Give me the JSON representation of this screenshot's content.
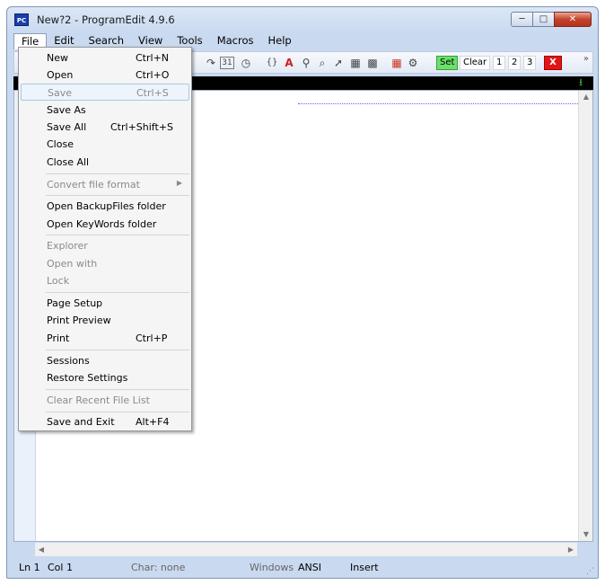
{
  "window": {
    "title": "New?2  -  ProgramEdit 4.9.6",
    "icon_label": "PC"
  },
  "menubar": [
    "File",
    "Edit",
    "Search",
    "View",
    "Tools",
    "Macros",
    "Help"
  ],
  "toolbar": {
    "set_label": "Set",
    "clear_label": "Clear",
    "slot1": "1",
    "slot2": "2",
    "slot3": "3",
    "close_label": "X",
    "colors": {
      "set": "#6be06b",
      "close": "#e01616",
      "download": "#3ed43e"
    }
  },
  "file_menu": [
    {
      "label": "New",
      "shortcut": "Ctrl+N",
      "disabled": false
    },
    {
      "label": "Open",
      "shortcut": "Ctrl+O",
      "disabled": false
    },
    {
      "label": "Save",
      "shortcut": "Ctrl+S",
      "disabled": true
    },
    {
      "label": "Save As",
      "shortcut": "",
      "disabled": false
    },
    {
      "label": "Save All",
      "shortcut": "Ctrl+Shift+S",
      "disabled": false
    },
    {
      "label": "Close",
      "shortcut": "",
      "disabled": false
    },
    {
      "label": "Close All",
      "shortcut": "",
      "disabled": false
    },
    {
      "label": "Convert file format",
      "shortcut": "",
      "disabled": true
    },
    {
      "label": "Open BackupFiles folder",
      "shortcut": "",
      "disabled": false
    },
    {
      "label": "Open KeyWords folder",
      "shortcut": "",
      "disabled": false
    },
    {
      "label": "Explorer",
      "shortcut": "",
      "disabled": true
    },
    {
      "label": "Open with",
      "shortcut": "",
      "disabled": true
    },
    {
      "label": "Lock",
      "shortcut": "",
      "disabled": true
    },
    {
      "label": "Page Setup",
      "shortcut": "",
      "disabled": false
    },
    {
      "label": "Print Preview",
      "shortcut": "",
      "disabled": false
    },
    {
      "label": "Print",
      "shortcut": "Ctrl+P",
      "disabled": false
    },
    {
      "label": "Sessions",
      "shortcut": "",
      "disabled": false
    },
    {
      "label": "Restore Settings",
      "shortcut": "",
      "disabled": false
    },
    {
      "label": "Clear Recent File List",
      "shortcut": "",
      "disabled": true
    },
    {
      "label": "Save and Exit",
      "shortcut": "Alt+F4",
      "disabled": false
    }
  ],
  "statusbar": {
    "line": "Ln 1",
    "col": "Col 1",
    "char": "Char: none",
    "line_endings": "Windows",
    "encoding": "ANSI",
    "mode": "Insert"
  }
}
